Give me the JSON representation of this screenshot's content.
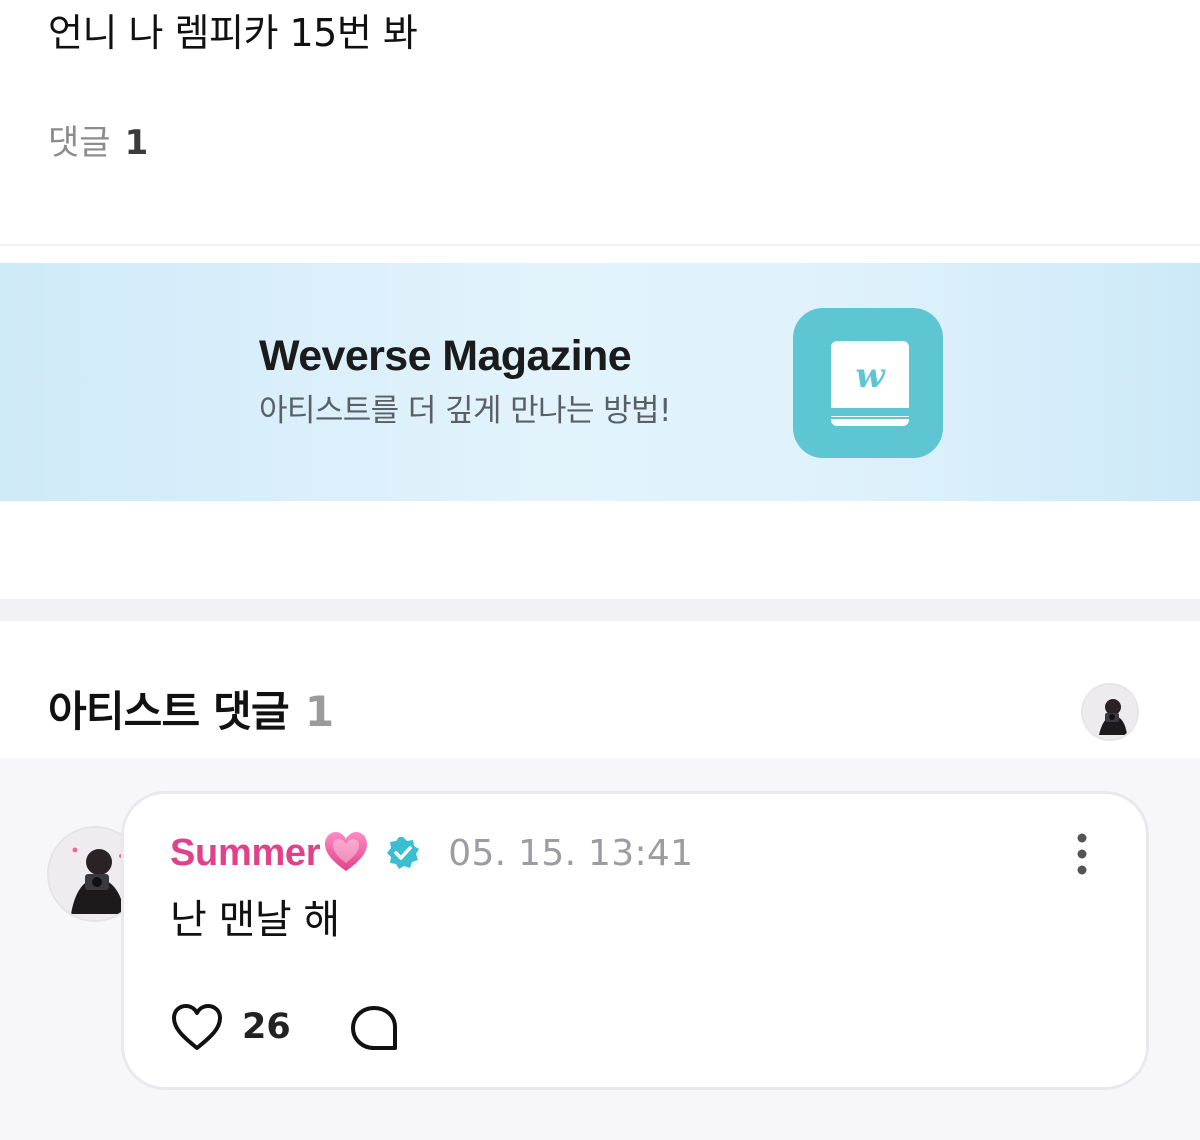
{
  "post": {
    "text": "언니 나 렘피카 15번 봐"
  },
  "comments_summary": {
    "label": "댓글",
    "count": "1"
  },
  "banner": {
    "title": "Weverse Magazine",
    "subtitle": "아티스트를 더 깊게 만나는 방법!",
    "icon": "weverse-magazine-book-icon",
    "icon_bg_color": "#5ec6d3",
    "bg_color": "#dff2fb"
  },
  "artist_comments": {
    "title": "아티스트 댓글",
    "count": "1",
    "avatar": "artist-avatar"
  },
  "comment": {
    "author": "Summer",
    "author_emoji": "💗",
    "author_color": "#e0418b",
    "verified_icon": "verified-check-icon",
    "time": "05. 15. 13:41",
    "body": "난 맨날 해",
    "likes": "26",
    "more_icon": "more-vertical-icon",
    "like_icon": "heart-outline-icon",
    "reply_icon": "reply-bubble-icon"
  }
}
